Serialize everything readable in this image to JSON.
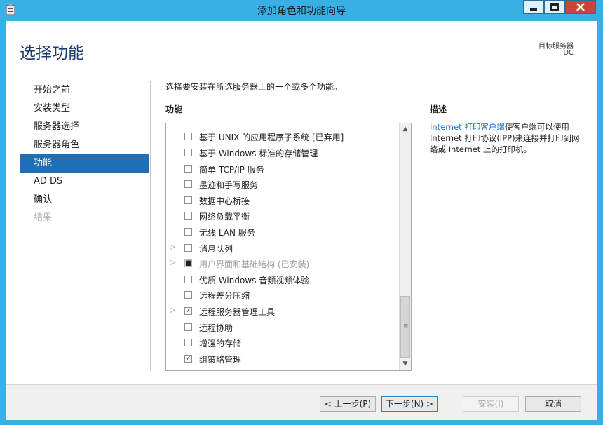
{
  "window": {
    "title": "添加角色和功能向导"
  },
  "header": {
    "page_title": "选择功能",
    "dest_label": "目标服务器",
    "dest_value": "DC"
  },
  "nav": {
    "items": [
      {
        "label": "开始之前",
        "state": "normal"
      },
      {
        "label": "安装类型",
        "state": "normal"
      },
      {
        "label": "服务器选择",
        "state": "normal"
      },
      {
        "label": "服务器角色",
        "state": "normal"
      },
      {
        "label": "功能",
        "state": "active"
      },
      {
        "label": "AD DS",
        "state": "normal"
      },
      {
        "label": "确认",
        "state": "normal"
      },
      {
        "label": "结果",
        "state": "disabled"
      }
    ]
  },
  "main": {
    "instruction": "选择要安装在所选服务器上的一个或多个功能。",
    "features_label": "功能",
    "features": [
      {
        "label": "基于 UNIX 的应用程序子系统 [已弃用]",
        "checked": false,
        "expandable": false,
        "dimmed": false
      },
      {
        "label": "基于 Windows 标准的存储管理",
        "checked": false,
        "expandable": false,
        "dimmed": false
      },
      {
        "label": "简单 TCP/IP 服务",
        "checked": false,
        "expandable": false,
        "dimmed": false
      },
      {
        "label": "墨迹和手写服务",
        "checked": false,
        "expandable": false,
        "dimmed": false
      },
      {
        "label": "数据中心桥接",
        "checked": false,
        "expandable": false,
        "dimmed": false
      },
      {
        "label": "网络负载平衡",
        "checked": false,
        "expandable": false,
        "dimmed": false
      },
      {
        "label": "无线 LAN 服务",
        "checked": false,
        "expandable": false,
        "dimmed": false
      },
      {
        "label": "消息队列",
        "checked": false,
        "expandable": true,
        "dimmed": false
      },
      {
        "label": "用户界面和基础结构 (已安装)",
        "checked": false,
        "expandable": true,
        "dimmed": true
      },
      {
        "label": "优质 Windows 音频视频体验",
        "checked": false,
        "expandable": false,
        "dimmed": false
      },
      {
        "label": "远程差分压缩",
        "checked": false,
        "expandable": false,
        "dimmed": false
      },
      {
        "label": "远程服务器管理工具",
        "checked": true,
        "expandable": true,
        "dimmed": false
      },
      {
        "label": "远程协助",
        "checked": false,
        "expandable": false,
        "dimmed": false
      },
      {
        "label": "增强的存储",
        "checked": false,
        "expandable": false,
        "dimmed": false
      },
      {
        "label": "组策略管理",
        "checked": true,
        "expandable": false,
        "dimmed": false
      }
    ]
  },
  "description": {
    "label": "描述",
    "link_text": "Internet 打印客户端",
    "text": "使客户端可以使用 Internet 打印协议(IPP)来连接并打印到网络或 Internet 上的打印机。"
  },
  "footer": {
    "prev_label": "< 上一步(P)",
    "next_label": "下一步(N) >",
    "install_label": "安装(I)",
    "cancel_label": "取消"
  },
  "icons": {
    "expander": "triangle-right-icon",
    "scroll_up": "chevron-up-icon",
    "scroll_down": "chevron-down-icon",
    "minimize": "minimize-icon",
    "maximize": "maximize-icon",
    "close": "close-icon"
  },
  "colors": {
    "window_frame": "#38b0e3",
    "active_nav": "#1e6fb5",
    "link": "#1b73c8",
    "close_button": "#c7463a"
  }
}
